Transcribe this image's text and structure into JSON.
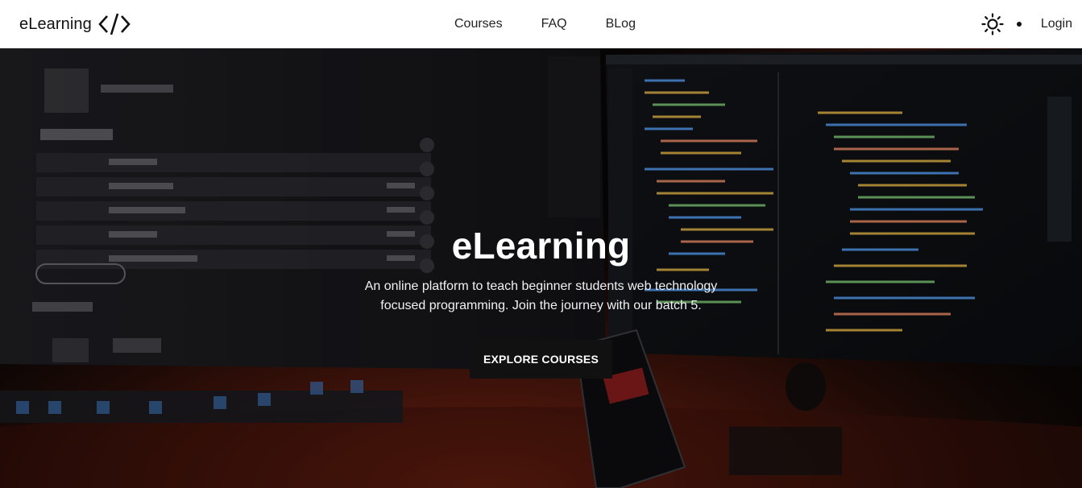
{
  "navbar": {
    "brand": "eLearning",
    "brand_icon": "code-icon",
    "links": [
      "Courses",
      "FAQ",
      "BLog"
    ],
    "theme_icon": "sun-icon",
    "login": "Login"
  },
  "hero": {
    "title": "eLearning",
    "description": "An online platform to teach beginner students web technology focused programming. Join the journey with our batch 5.",
    "button": "EXPLORE COURSES"
  },
  "colors": {
    "navbar_bg": "#ffffff",
    "button_bg": "#111111",
    "hero_glow": "#7a2414"
  }
}
